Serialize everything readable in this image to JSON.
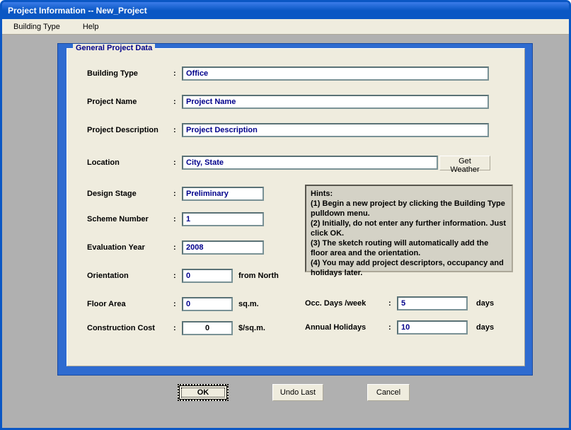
{
  "window": {
    "title": "Project Information -- New_Project"
  },
  "menu": {
    "buildingType": "Building Type",
    "help": "Help"
  },
  "legend": "General Project Data",
  "labels": {
    "buildingType": "Building Type",
    "projectName": "Project  Name",
    "projectDescription": "Project Description",
    "location": "Location",
    "designStage": "Design Stage",
    "schemeNumber": "Scheme Number",
    "evaluationYear": "Evaluation Year",
    "orientation": "Orientation",
    "floorArea": "Floor Area",
    "constructionCost": "Construction Cost",
    "occDays": "Occ. Days /week",
    "annualHolidays": "Annual Holidays"
  },
  "colon": ":",
  "values": {
    "buildingType": "Office",
    "projectName": "Project Name",
    "projectDescription": "Project Description",
    "location": "City, State",
    "designStage": "Preliminary",
    "schemeNumber": "1",
    "evaluationYear": "2008",
    "orientation": "0",
    "floorArea": "0",
    "constructionCost": "0",
    "occDays": "5",
    "annualHolidays": "10"
  },
  "units": {
    "orientation": "from North",
    "floorArea": "sq.m.",
    "constructionCost": "$/sq.m.",
    "occDays": "days",
    "annualHolidays": "days"
  },
  "buttons": {
    "getWeather": "Get Weather",
    "ok": "OK",
    "undoLast": "Undo Last",
    "cancel": "Cancel"
  },
  "hints": {
    "title": "Hints:",
    "l1": "(1)  Begin a new project by clicking the Building Type pulldown menu.",
    "l2": "(2) Initially, do not enter any further information.  Just click OK.",
    "l3": "(3) The sketch routing will automatically add the floor area and the orientation.",
    "l4": "(4) You may add project descriptors, occupancy and holidays later."
  }
}
